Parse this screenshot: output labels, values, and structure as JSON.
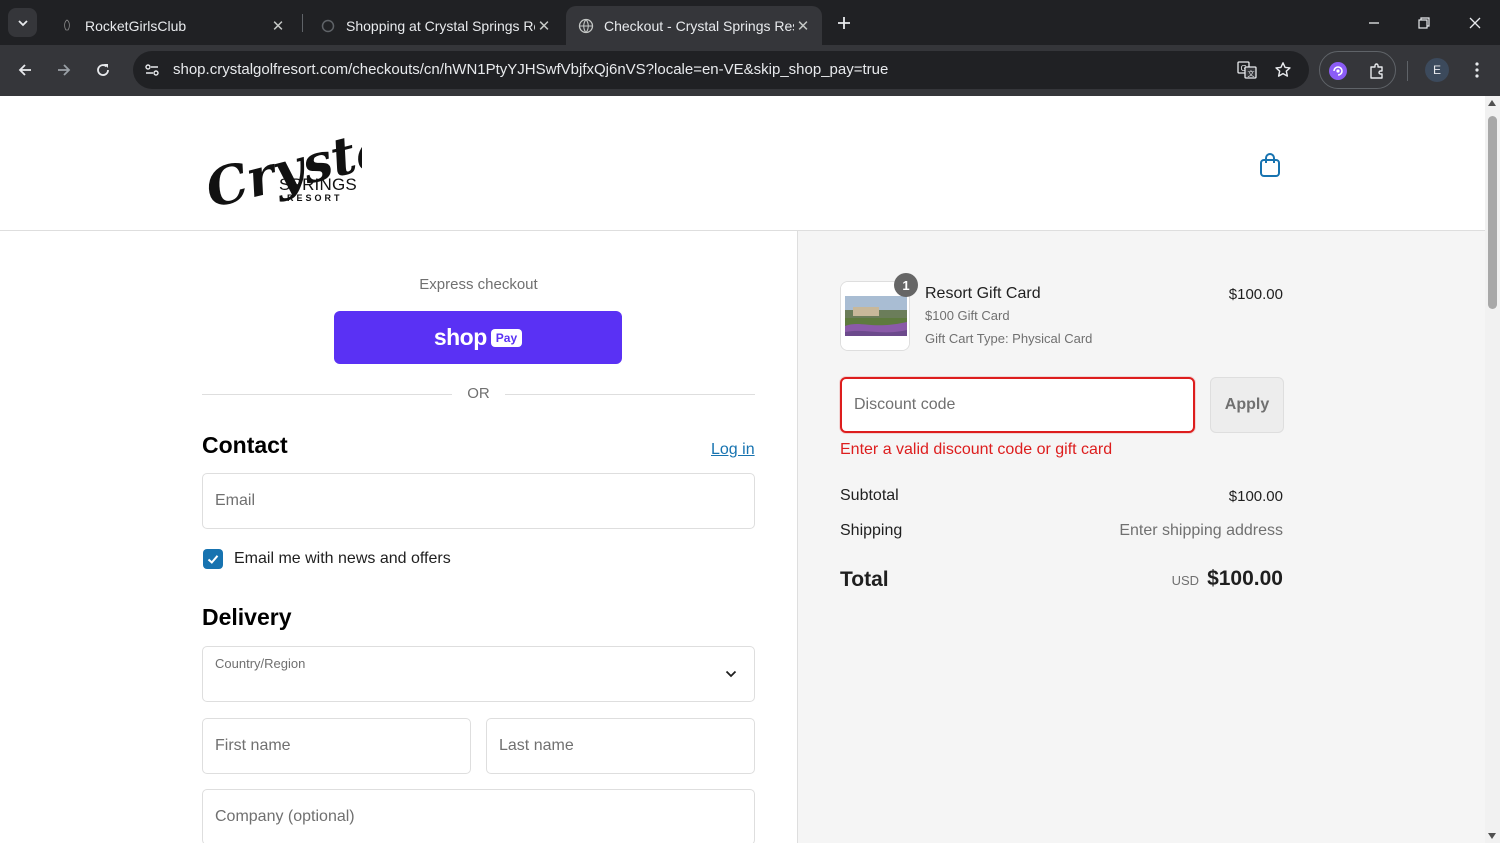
{
  "browser": {
    "tabs": [
      {
        "title": "RocketGirlsClub",
        "active": false
      },
      {
        "title": "Shopping at Crystal Springs Res",
        "active": false
      },
      {
        "title": "Checkout - Crystal Springs Reso",
        "active": true
      }
    ],
    "url": "shop.crystalgolfresort.com/checkouts/cn/hWN1PtyYJHSwfVbjfxQj6nVS?locale=en-VE&skip_shop_pay=true",
    "profile_initial": "E",
    "icons": [
      "tab-search-icon",
      "close-icon",
      "new-tab-icon",
      "minimize-icon",
      "restore-icon",
      "back-icon",
      "forward-icon",
      "reload-icon",
      "site-settings-icon",
      "translate-icon",
      "bookmark-star-icon",
      "extension-icon",
      "puzzle-icon",
      "menu-dots-icon"
    ]
  },
  "store": {
    "logo_script": "Crystal",
    "logo_springs": "SPRINGS",
    "logo_resort": "RESORT",
    "cart_icon": "shopping-bag-icon"
  },
  "checkout": {
    "express_label": "Express checkout",
    "shop_pay_word": "shop",
    "shop_pay_pill": "Pay",
    "or_label": "OR",
    "contact": {
      "title": "Contact",
      "login_link": "Log in",
      "email_placeholder": "Email",
      "newsletter_label": "Email me with news and offers",
      "newsletter_checked": true
    },
    "delivery": {
      "title": "Delivery",
      "country_label": "Country/Region",
      "first_name_placeholder": "First name",
      "last_name_placeholder": "Last name",
      "company_placeholder": "Company (optional)"
    }
  },
  "summary": {
    "item": {
      "quantity": "1",
      "name": "Resort Gift Card",
      "variant": "$100 Gift Card",
      "property": "Gift Cart Type: Physical Card",
      "price": "$100.00"
    },
    "discount_placeholder": "Discount code",
    "apply_label": "Apply",
    "error_message": "Enter a valid discount code or gift card",
    "subtotal_label": "Subtotal",
    "subtotal_value": "$100.00",
    "shipping_label": "Shipping",
    "shipping_value": "Enter shipping address",
    "total_label": "Total",
    "total_currency": "USD",
    "total_value": "$100.00"
  },
  "colors": {
    "shop_pay": "#5a31f4",
    "link": "#1773b0",
    "error": "#dd1d1d",
    "chrome_dark": "#202124",
    "chrome_toolbar": "#35363a"
  }
}
